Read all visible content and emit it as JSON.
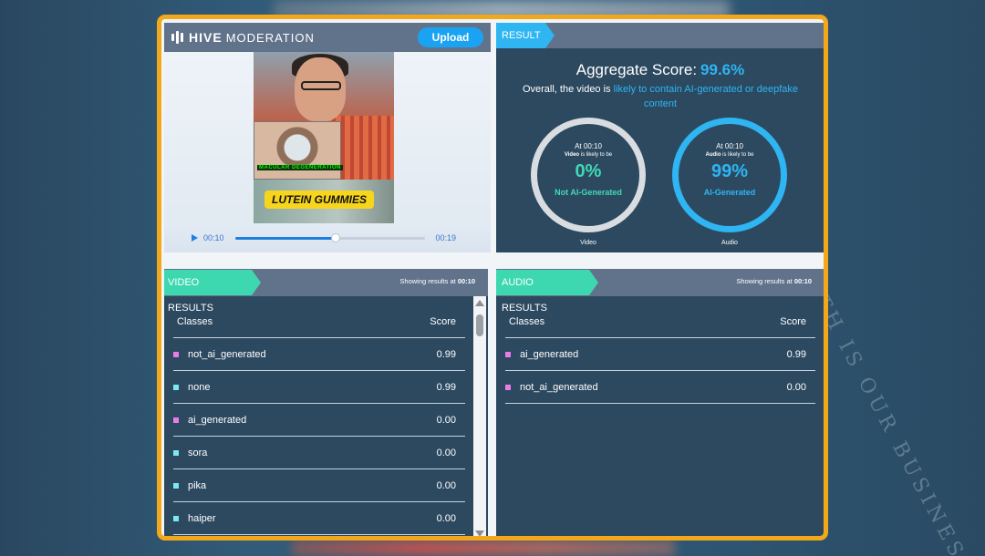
{
  "app": {
    "brand_bold": "HIVE",
    "brand_light": "MODERATION",
    "upload_label": "Upload"
  },
  "player": {
    "current_time": "00:10",
    "duration": "00:19",
    "progress_fraction": 0.53,
    "overlay_caption": "MACULAR DEGENERATION",
    "banner_text": "LUTEIN GUMMIES"
  },
  "result": {
    "tag": "RESULT",
    "aggregate_label": "Aggregate Score:",
    "aggregate_value": "99.6%",
    "overall_prefix": "Overall, the video is",
    "overall_highlight": "likely to contain AI-generated or deepfake content",
    "video_gauge": {
      "at": "At 00:10",
      "modality": "Video",
      "likely_suffix": "is likely to be",
      "percent": "0%",
      "verdict": "Not AI-Generated",
      "caption": "Video",
      "ring_color": "#d9dde1"
    },
    "audio_gauge": {
      "at": "At 00:10",
      "modality": "Audio",
      "likely_suffix": "is likely to be",
      "percent": "99%",
      "verdict": "AI-Generated",
      "caption": "Audio",
      "ring_color": "#2eb5f2"
    }
  },
  "video_results": {
    "tag": "VIDEO RESULTS",
    "showing_prefix": "Showing results at",
    "showing_time": "00:10",
    "col_class": "Classes",
    "col_score": "Score",
    "rows": [
      {
        "cls": "not_ai_generated",
        "score": "0.99",
        "color": "#e87de8"
      },
      {
        "cls": "none",
        "score": "0.99",
        "color": "#7ee8f0"
      },
      {
        "cls": "ai_generated",
        "score": "0.00",
        "color": "#e87de8"
      },
      {
        "cls": "sora",
        "score": "0.00",
        "color": "#7ee8f0"
      },
      {
        "cls": "pika",
        "score": "0.00",
        "color": "#7ee8f0"
      },
      {
        "cls": "haiper",
        "score": "0.00",
        "color": "#7ee8f0"
      }
    ]
  },
  "audio_results": {
    "tag": "AUDIO RESULTS",
    "showing_prefix": "Showing results at",
    "showing_time": "00:10",
    "col_class": "Classes",
    "col_score": "Score",
    "rows": [
      {
        "cls": "ai_generated",
        "score": "0.99",
        "color": "#e87de8"
      },
      {
        "cls": "not_ai_generated",
        "score": "0.00",
        "color": "#e87de8"
      }
    ]
  },
  "watermark": "TH IS OUR BUSINESS"
}
